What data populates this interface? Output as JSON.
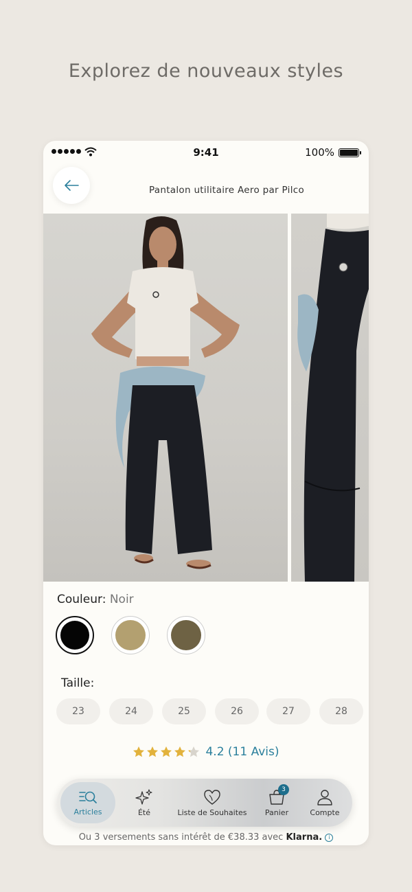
{
  "headline": "Explorez de nouveaux styles",
  "status_bar": {
    "time": "9:41",
    "battery": "100%"
  },
  "product": {
    "title": "Pantalon utilitaire Aero par Pilco"
  },
  "color": {
    "label": "Couleur:",
    "selected": "Noir",
    "swatches": [
      {
        "name": "Noir",
        "hex": "#050505",
        "selected": true
      },
      {
        "name": "Beige",
        "hex": "#b3a070",
        "selected": false
      },
      {
        "name": "Olive",
        "hex": "#6e6244",
        "selected": false
      }
    ]
  },
  "size": {
    "label": "Taille:",
    "options": [
      "23",
      "24",
      "25",
      "26",
      "27",
      "28"
    ]
  },
  "rating": {
    "value": 4.2,
    "text": "4.2 (11 Avis)",
    "star_color": "#e2b23c"
  },
  "tabbar": {
    "tabs": [
      {
        "label": "Articles",
        "icon": "search-list-icon",
        "active": true
      },
      {
        "label": "Été",
        "icon": "sparkles-icon",
        "active": false
      },
      {
        "label": "Liste de Souhaites",
        "icon": "heart-icon",
        "active": false
      },
      {
        "label": "Panier",
        "icon": "bag-icon",
        "active": false,
        "badge": "3"
      },
      {
        "label": "Compte",
        "icon": "person-icon",
        "active": false
      }
    ]
  },
  "installments": {
    "text": "Ou 3 versements sans intérêt de €38.33 avec",
    "brand": "Klarna."
  },
  "colors": {
    "accent": "#2a7f9c",
    "background": "#ece8e2",
    "card": "#fdfcf8"
  }
}
